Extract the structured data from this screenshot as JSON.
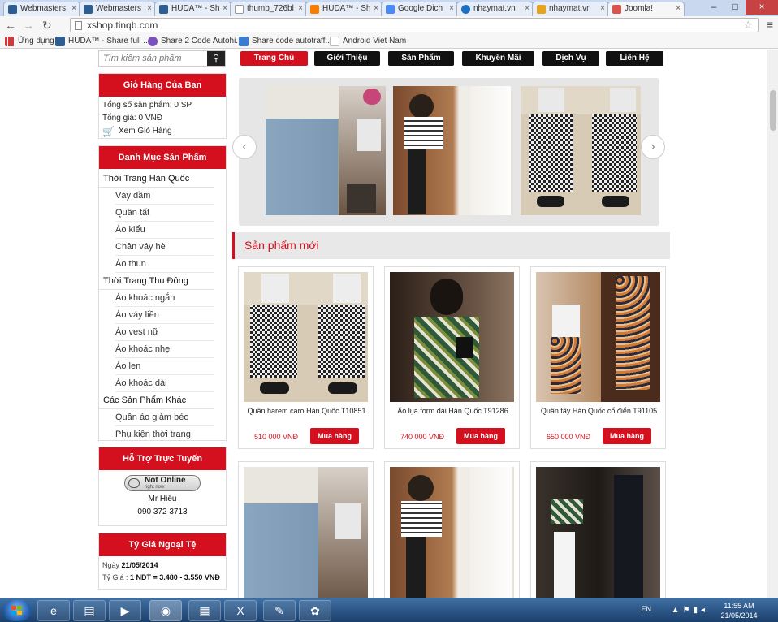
{
  "browser": {
    "tabs": [
      {
        "title": "Webmasters",
        "color": "#2e5d91"
      },
      {
        "title": "Webmasters",
        "color": "#2e5d91"
      },
      {
        "title": "HUDA™ - Sh",
        "color": "#2e5d91"
      },
      {
        "title": "thumb_726bl",
        "color": "#ffffff"
      },
      {
        "title": "HUDA™ - Sh",
        "color": "#f57d00"
      },
      {
        "title": "Google Dich",
        "color": "#4a8af4"
      },
      {
        "title": "nhaymat.vn",
        "color": "#1d6fc1"
      },
      {
        "title": "nhaymat.vn",
        "color": "#e4a320"
      },
      {
        "title": "Joomla!",
        "color": "#d9534f"
      }
    ],
    "url": "xshop.tinqb.com",
    "bookmarks": [
      {
        "label": "Ứng dụng"
      },
      {
        "label": "HUDA™ - Share full ..."
      },
      {
        "label": "Share 2 Code Autohi..."
      },
      {
        "label": "Share code autotraff..."
      },
      {
        "label": "Android Viet Nam"
      }
    ]
  },
  "search": {
    "placeholder": "Tìm kiếm sản phẩm",
    "button": "🔍"
  },
  "nav": [
    "Trang Chủ",
    "Giới Thiệu",
    "Sản Phẩm",
    "Khuyến Mãi",
    "Dịch Vụ",
    "Liên Hệ"
  ],
  "cart": {
    "title": "Giỏ Hàng Của Bạn",
    "count_line": "Tổng số sản phẩm: 0 SP",
    "total_line": "Tổng giá: 0 VNĐ",
    "view_label": "Xem Giỏ Hàng"
  },
  "categories": {
    "title": "Danh Mục Sản Phẩm",
    "groups": [
      {
        "name": "Thời Trang Hàn Quốc",
        "items": [
          "Váy đầm",
          "Quần tất",
          "Áo kiểu",
          "Chân váy hè",
          "Áo thun"
        ]
      },
      {
        "name": "Thời Trang Thu Đông",
        "items": [
          "Áo khoác ngắn",
          "Áo váy liền",
          "Áo vest nữ",
          "Áo khoác nhẹ",
          "Áo len",
          "Áo khoác dài"
        ]
      },
      {
        "name": "Các Sản Phẩm Khác",
        "items": [
          "Quần áo giảm béo",
          "Phụ kiện thời trang"
        ]
      }
    ]
  },
  "support": {
    "title": "Hỗ Trợ Trực Tuyến",
    "status": "Not Online",
    "status_sub": "right now",
    "name": "Mr Hiếu",
    "phone": "090 372 3713"
  },
  "fx": {
    "title": "Tỷ Giá Ngoại Tệ",
    "date_label": "Ngày",
    "date": "21/05/2014",
    "rate_label": "Tỷ Giá :",
    "rate": "1 NDT = 3.480 - 3.550 VNĐ"
  },
  "section_title": "Sản phẩm mới",
  "products": [
    {
      "name": "Quần harem caro Hàn Quốc T10851",
      "price": "510 000 VNĐ",
      "buy": "Mua hàng"
    },
    {
      "name": "Áo lụa form dài Hàn Quốc T91286",
      "price": "740 000 VNĐ",
      "buy": "Mua hàng"
    },
    {
      "name": "Quần tây Hàn Quốc cổ điển T91105",
      "price": "650 000 VNĐ",
      "buy": "Mua hàng"
    }
  ],
  "taskbar": {
    "lang": "EN",
    "time": "11:55 AM",
    "date": "21/05/2014"
  },
  "colors": {
    "accent": "#d40f1e",
    "nav_dark": "#111111"
  }
}
